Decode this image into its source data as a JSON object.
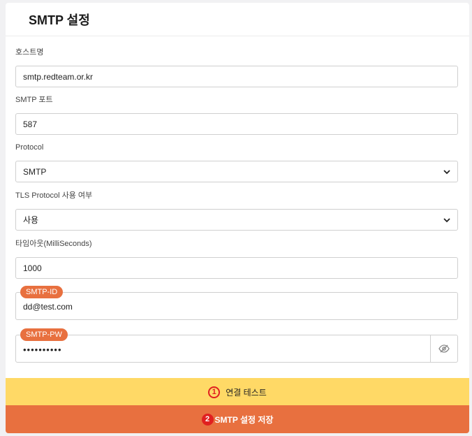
{
  "card": {
    "title": "SMTP 설정"
  },
  "fields": {
    "host": {
      "label": "호스트명",
      "value": "smtp.redteam.or.kr"
    },
    "port": {
      "label": "SMTP 포트",
      "value": "587"
    },
    "protocol": {
      "label": "Protocol",
      "selected": "SMTP"
    },
    "tls": {
      "label": "TLS Protocol 사용 여부",
      "selected": "사용"
    },
    "timeout": {
      "label": "타임아웃(MilliSeconds)",
      "value": "1000"
    },
    "smtp_id": {
      "label": "SMTP-ID",
      "value": "dd@test.com"
    },
    "smtp_pw": {
      "label": "SMTP-PW",
      "value": "••••••••••"
    }
  },
  "buttons": {
    "test": {
      "marker": "1",
      "label": "연결 테스트"
    },
    "save": {
      "marker": "2",
      "label": "SMTP 설정 저장"
    }
  },
  "icons": {
    "select": "chevron-down-icon",
    "password": "eye-slash-icon"
  },
  "colors": {
    "accent": "#e8703f",
    "test_button": "#ffd966",
    "marker": "#e02020"
  }
}
